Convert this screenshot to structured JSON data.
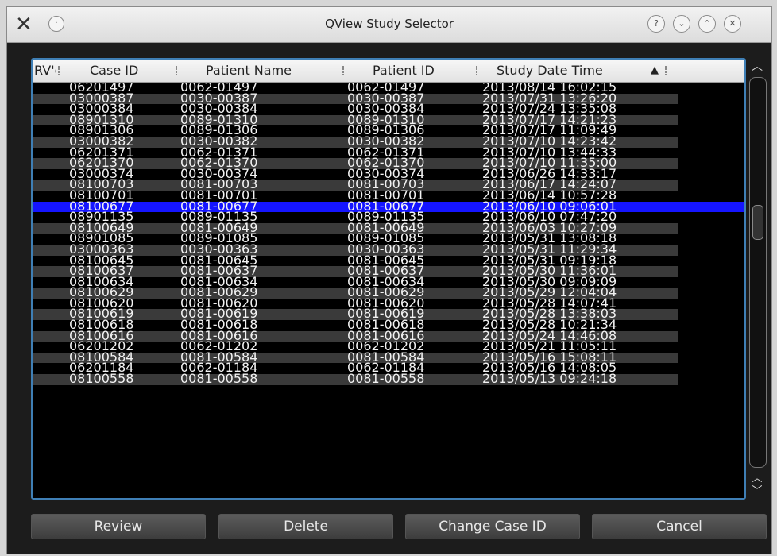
{
  "window": {
    "title": "QView Study Selector",
    "icons": {
      "app": "x-logo-icon",
      "pin": "pin-icon",
      "help": "help-icon",
      "minimize": "minimize-icon",
      "maximize": "maximize-icon",
      "close": "close-icon"
    }
  },
  "table": {
    "columns": [
      "RV'c",
      "Case ID",
      "Patient Name",
      "Patient ID",
      "Study Date Time"
    ],
    "sort_indicator": "▲",
    "selected_index": 11,
    "rows": [
      {
        "case_id": "06201497",
        "patient_name": "0062-01497",
        "patient_id": "0062-01497",
        "study_date": "2013/08/14 16:02:15"
      },
      {
        "case_id": "03000387",
        "patient_name": "0030-00387",
        "patient_id": "0030-00387",
        "study_date": "2013/07/31 13:26:20"
      },
      {
        "case_id": "03000384",
        "patient_name": "0030-00384",
        "patient_id": "0030-00384",
        "study_date": "2013/07/24 13:35:08"
      },
      {
        "case_id": "08901310",
        "patient_name": "0089-01310",
        "patient_id": "0089-01310",
        "study_date": "2013/07/17 14:21:23"
      },
      {
        "case_id": "08901306",
        "patient_name": "0089-01306",
        "patient_id": "0089-01306",
        "study_date": "2013/07/17 11:09:49"
      },
      {
        "case_id": "03000382",
        "patient_name": "0030-00382",
        "patient_id": "0030-00382",
        "study_date": "2013/07/10 14:23:42"
      },
      {
        "case_id": "06201371",
        "patient_name": "0062-01371",
        "patient_id": "0062-01371",
        "study_date": "2013/07/10 13:44:33"
      },
      {
        "case_id": "06201370",
        "patient_name": "0062-01370",
        "patient_id": "0062-01370",
        "study_date": "2013/07/10 11:35:00"
      },
      {
        "case_id": "03000374",
        "patient_name": "0030-00374",
        "patient_id": "0030-00374",
        "study_date": "2013/06/26 14:33:17"
      },
      {
        "case_id": "08100703",
        "patient_name": "0081-00703",
        "patient_id": "0081-00703",
        "study_date": "2013/06/17 14:24:07"
      },
      {
        "case_id": "08100701",
        "patient_name": "0081-00701",
        "patient_id": "0081-00701",
        "study_date": "2013/06/14 10:57:28"
      },
      {
        "case_id": "08100677",
        "patient_name": "0081-00677",
        "patient_id": "0081-00677",
        "study_date": "2013/06/10 09:06:01"
      },
      {
        "case_id": "08901135",
        "patient_name": "0089-01135",
        "patient_id": "0089-01135",
        "study_date": "2013/06/10 07:47:20"
      },
      {
        "case_id": "08100649",
        "patient_name": "0081-00649",
        "patient_id": "0081-00649",
        "study_date": "2013/06/03 10:27:09"
      },
      {
        "case_id": "08901085",
        "patient_name": "0089-01085",
        "patient_id": "0089-01085",
        "study_date": "2013/05/31 13:08:18"
      },
      {
        "case_id": "03000363",
        "patient_name": "0030-00363",
        "patient_id": "0030-00363",
        "study_date": "2013/05/31 11:29:34"
      },
      {
        "case_id": "08100645",
        "patient_name": "0081-00645",
        "patient_id": "0081-00645",
        "study_date": "2013/05/31 09:19:18"
      },
      {
        "case_id": "08100637",
        "patient_name": "0081-00637",
        "patient_id": "0081-00637",
        "study_date": "2013/05/30 11:36:01"
      },
      {
        "case_id": "08100634",
        "patient_name": "0081-00634",
        "patient_id": "0081-00634",
        "study_date": "2013/05/30 09:09:09"
      },
      {
        "case_id": "08100629",
        "patient_name": "0081-00629",
        "patient_id": "0081-00629",
        "study_date": "2013/05/29 12:04:04"
      },
      {
        "case_id": "08100620",
        "patient_name": "0081-00620",
        "patient_id": "0081-00620",
        "study_date": "2013/05/28 14:07:41"
      },
      {
        "case_id": "08100619",
        "patient_name": "0081-00619",
        "patient_id": "0081-00619",
        "study_date": "2013/05/28 13:38:03"
      },
      {
        "case_id": "08100618",
        "patient_name": "0081-00618",
        "patient_id": "0081-00618",
        "study_date": "2013/05/28 10:21:34"
      },
      {
        "case_id": "08100616",
        "patient_name": "0081-00616",
        "patient_id": "0081-00616",
        "study_date": "2013/05/24 14:46:08"
      },
      {
        "case_id": "06201202",
        "patient_name": "0062-01202",
        "patient_id": "0062-01202",
        "study_date": "2013/05/21 11:05:11"
      },
      {
        "case_id": "08100584",
        "patient_name": "0081-00584",
        "patient_id": "0081-00584",
        "study_date": "2013/05/16 15:08:11"
      },
      {
        "case_id": "06201184",
        "patient_name": "0062-01184",
        "patient_id": "0062-01184",
        "study_date": "2013/05/16 14:08:05"
      },
      {
        "case_id": "08100558",
        "patient_name": "0081-00558",
        "patient_id": "0081-00558",
        "study_date": "2013/05/13 09:24:18"
      }
    ]
  },
  "buttons": {
    "review": "Review",
    "delete": "Delete",
    "change_case_id": "Change Case ID",
    "cancel": "Cancel"
  },
  "scrollbar": {
    "up_icon": "chevron-up-icon",
    "down_icon": "chevron-down-icon"
  },
  "colors": {
    "selection": "#1515ff",
    "frame_border": "#3f7fb5",
    "row_alt": "#3a3a3a"
  }
}
